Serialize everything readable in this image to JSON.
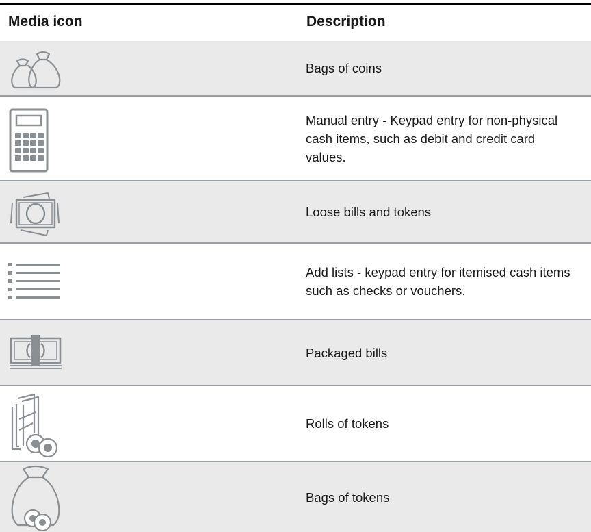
{
  "header": {
    "col1": "Media icon",
    "col2": "Description"
  },
  "rows": [
    {
      "icon": "money-bags-icon",
      "description": "Bags of coins"
    },
    {
      "icon": "calculator-icon",
      "description": "Manual entry - Keypad entry for non-physical cash items, such as debit and credit card values."
    },
    {
      "icon": "loose-bills-icon",
      "description": "Loose bills and tokens"
    },
    {
      "icon": "list-icon",
      "description": "Add lists - keypad entry for itemised cash items such as checks or vouchers."
    },
    {
      "icon": "packaged-bills-icon",
      "description": "Packaged bills"
    },
    {
      "icon": "token-rolls-icon",
      "description": "Rolls of tokens"
    },
    {
      "icon": "token-bag-icon",
      "description": "Bags of tokens"
    }
  ],
  "colors": {
    "icon": "#8a8f94",
    "alt_row": "#eaeaea",
    "rule": "#000000",
    "separator": "#9aa0a6"
  }
}
